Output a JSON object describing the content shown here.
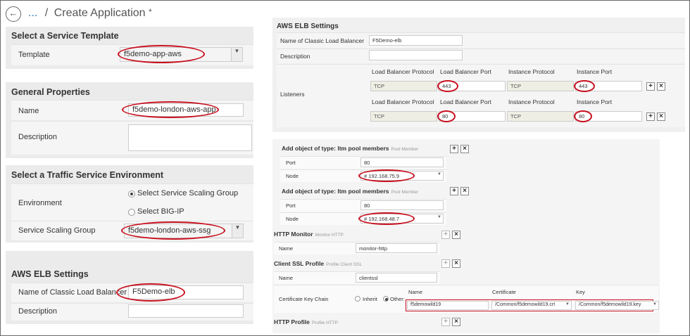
{
  "header": {
    "breadcrumb_dots": "...",
    "separator": "/",
    "title": "Create Application",
    "asterisk": "*"
  },
  "left": {
    "template_section": {
      "heading": "Select a Service Template",
      "label": "Template",
      "value": "f5demo-app-aws"
    },
    "general": {
      "heading": "General Properties",
      "name_label": "Name",
      "name_value": "f5demo-london-aws-app",
      "desc_label": "Description"
    },
    "tse": {
      "heading": "Select a Traffic Service Environment",
      "env_label": "Environment",
      "opt1": "Select Service Scaling Group",
      "opt2": "Select BIG-IP",
      "ssg_label": "Service Scaling Group",
      "ssg_value": "f5demo-london-aws-ssg"
    },
    "elb": {
      "heading": "AWS ELB Settings",
      "name_label": "Name of Classic Load Balancer",
      "name_value": "F5Demo-elb",
      "desc_label": "Description"
    }
  },
  "right_top": {
    "heading": "AWS ELB Settings",
    "name_label": "Name of Classic Load Balancer",
    "name_value": "F5Demo-elb",
    "desc_label": "Description",
    "listeners_label": "Listeners",
    "col_headers": [
      "Load Balancer Protocol",
      "Load Balancer Port",
      "Instance Protocol",
      "Instance Port"
    ],
    "listeners": [
      {
        "lbp": "TCP",
        "lbport": "443",
        "ip": "TCP",
        "iport": "443"
      },
      {
        "lbp": "TCP",
        "lbport": "80",
        "ip": "TCP",
        "iport": "80"
      }
    ],
    "add": "+",
    "remove": "×"
  },
  "right_bottom": {
    "pool1": {
      "heading": "Add object of type: ltm pool members",
      "sub": "Pool Member",
      "port_label": "Port",
      "port_value": "80",
      "node_label": "Node",
      "node_value": "# 192.168.75.9"
    },
    "pool2": {
      "heading": "Add object of type: ltm pool members",
      "sub": "Pool Member",
      "port_label": "Port",
      "port_value": "80",
      "node_label": "Node",
      "node_value": "# 192.168.48.7"
    },
    "monitor": {
      "heading": "HTTP Monitor",
      "sub": "Monitor HTTP",
      "name_label": "Name",
      "name_value": "monitor-http"
    },
    "ssl": {
      "heading": "Client SSL Profile",
      "sub": "Profile Client SSL",
      "name_label": "Name",
      "name_value": "clientssl",
      "chain_label": "Certificate Key Chain",
      "inherit": "Inherit",
      "other": "Other:",
      "cols": [
        "Name",
        "Certificate",
        "Key"
      ],
      "chain_name": "f5demowild19",
      "chain_cert": "/Common/f5demowild19.crt",
      "chain_key": "/Common/f5demowild19.key"
    },
    "http": {
      "heading": "HTTP Profile",
      "sub": "Profile HTTP"
    },
    "add": "+",
    "remove": "×"
  },
  "colors": {
    "highlight_ring": "#c8101f",
    "section_bg": "#ebebeb",
    "row_bg": "#f5f5f5"
  }
}
